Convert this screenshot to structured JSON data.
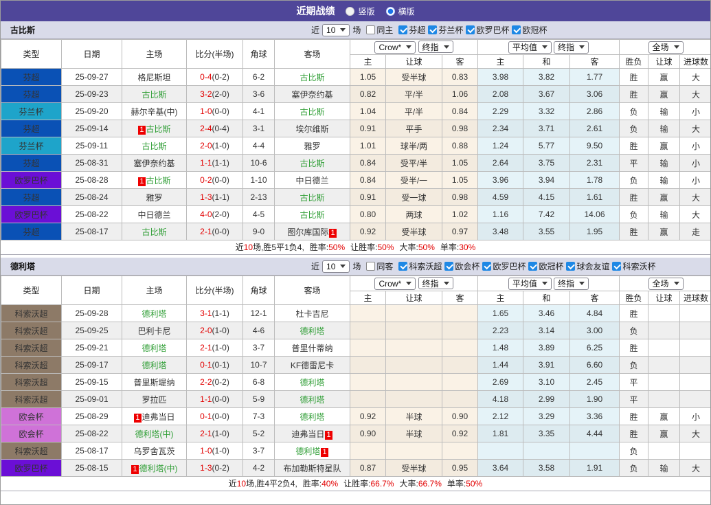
{
  "header": {
    "title": "近期战绩",
    "radio1_label": "竖版",
    "radio1_state": "off",
    "radio2_label": "横版",
    "radio2_state": "on"
  },
  "labels": {
    "recent": "近",
    "games": "场",
    "col_type": "类型",
    "col_date": "日期",
    "col_home": "主场",
    "col_score": "比分(半场)",
    "col_corner": "角球",
    "col_away": "客场",
    "crow": "Crow*",
    "final": "终指",
    "avg": "平均值",
    "full": "全场",
    "home": "主",
    "handicap": "让球",
    "away": "客",
    "draw": "和",
    "result": "胜负",
    "goals": "进球数",
    "sum_prefix": "近",
    "sum_games_suffix": "场,",
    "win_rate": "胜率:",
    "hcap_rate": "让胜率:",
    "big_rate": "大率:",
    "single_rate": "单率:"
  },
  "colors": {
    "topbar": "#4f4699",
    "section_strip": "#d9dbe9",
    "league_colors": {
      "芬超": "#0a51b5",
      "芬兰杯": "#1ea4ca",
      "欧罗巴杯": "#6b0fd6",
      "科索沃超": "#8d7a67",
      "欧会杯": "#cf72d8"
    },
    "win_red": "#e20000",
    "lose_blue": "#2323c8",
    "draw_green": "#2f9e35",
    "team_green": "#2f9e35"
  },
  "sections": [
    {
      "team": "古比斯",
      "count": "10",
      "same_label": "同主",
      "same_state": "off",
      "leagues": [
        "芬超",
        "芬兰杯",
        "欧罗巴杯",
        "欧冠杯"
      ],
      "rows": [
        {
          "type": "芬超",
          "tclass": "fc",
          "date": "25-09-27",
          "hpre": "",
          "home": "格尼斯坦",
          "hcls": "",
          "ft": "0-4",
          "ht": "(0-2)",
          "corner": "6-2",
          "away": "古比斯",
          "apost": "",
          "acls": "tg",
          "o1": "1.05",
          "o2": "受半球",
          "o3": "0.83",
          "m1": "3.98",
          "m2": "3.82",
          "m3": "1.77",
          "r1": "胜",
          "r1c": "r",
          "r2": "赢",
          "r2c": "r",
          "r3": "大",
          "r3c": "r"
        },
        {
          "type": "芬超",
          "tclass": "fc",
          "date": "25-09-23",
          "hpre": "",
          "home": "古比斯",
          "hcls": "tg",
          "ft": "3-2",
          "ht": "(2-0)",
          "corner": "3-6",
          "away": "塞伊奈约基",
          "apost": "",
          "acls": "",
          "o1": "0.82",
          "o2": "平/半",
          "o3": "1.06",
          "m1": "2.08",
          "m2": "3.67",
          "m3": "3.06",
          "r1": "胜",
          "r1c": "r",
          "r2": "赢",
          "r2c": "r",
          "r3": "大",
          "r3c": "r"
        },
        {
          "type": "芬兰杯",
          "tclass": "fl",
          "date": "25-09-20",
          "hpre": "",
          "home": "赫尔辛基(中)",
          "hcls": "",
          "ft": "1-0",
          "ht": "(0-0)",
          "corner": "4-1",
          "away": "古比斯",
          "apost": "",
          "acls": "tg",
          "o1": "1.04",
          "o2": "平/半",
          "o3": "0.84",
          "m1": "2.29",
          "m2": "3.32",
          "m3": "2.86",
          "r1": "负",
          "r1c": "b",
          "r2": "输",
          "r2c": "b",
          "r3": "小",
          "r3c": "b"
        },
        {
          "type": "芬超",
          "tclass": "fc",
          "date": "25-09-14",
          "hpre": "1",
          "home": "古比斯",
          "hcls": "tg",
          "ft": "2-4",
          "ht": "(0-4)",
          "corner": "3-1",
          "away": "埃尔维斯",
          "apost": "",
          "acls": "",
          "o1": "0.91",
          "o2": "平手",
          "o3": "0.98",
          "m1": "2.34",
          "m2": "3.71",
          "m3": "2.61",
          "r1": "负",
          "r1c": "b",
          "r2": "输",
          "r2c": "b",
          "r3": "大",
          "r3c": "r"
        },
        {
          "type": "芬兰杯",
          "tclass": "fl",
          "date": "25-09-11",
          "hpre": "",
          "home": "古比斯",
          "hcls": "tg",
          "ft": "2-0",
          "ht": "(1-0)",
          "corner": "4-4",
          "away": "雅罗",
          "apost": "",
          "acls": "",
          "o1": "1.01",
          "o2": "球半/两",
          "o3": "0.88",
          "m1": "1.24",
          "m2": "5.77",
          "m3": "9.50",
          "r1": "胜",
          "r1c": "r",
          "r2": "赢",
          "r2c": "r",
          "r3": "小",
          "r3c": "b"
        },
        {
          "type": "芬超",
          "tclass": "fc",
          "date": "25-08-31",
          "hpre": "",
          "home": "塞伊奈约基",
          "hcls": "",
          "ft": "1-1",
          "ht": "(1-1)",
          "corner": "10-6",
          "away": "古比斯",
          "apost": "",
          "acls": "tg",
          "o1": "0.84",
          "o2": "受平/半",
          "o3": "1.05",
          "m1": "2.64",
          "m2": "3.75",
          "m3": "2.31",
          "r1": "平",
          "r1c": "g",
          "r2": "输",
          "r2c": "b",
          "r3": "小",
          "r3c": "b"
        },
        {
          "type": "欧罗巴杯",
          "tclass": "eu",
          "date": "25-08-28",
          "hpre": "1",
          "home": "古比斯",
          "hcls": "tg",
          "ft": "0-2",
          "ht": "(0-0)",
          "corner": "1-10",
          "away": "中日德兰",
          "apost": "",
          "acls": "",
          "o1": "0.84",
          "o2": "受半/一",
          "o3": "1.05",
          "m1": "3.96",
          "m2": "3.94",
          "m3": "1.78",
          "r1": "负",
          "r1c": "b",
          "r2": "输",
          "r2c": "b",
          "r3": "小",
          "r3c": "b"
        },
        {
          "type": "芬超",
          "tclass": "fc",
          "date": "25-08-24",
          "hpre": "",
          "home": "雅罗",
          "hcls": "",
          "ft": "1-3",
          "ht": "(1-1)",
          "corner": "2-13",
          "away": "古比斯",
          "apost": "",
          "acls": "tg",
          "o1": "0.91",
          "o2": "受一球",
          "o3": "0.98",
          "m1": "4.59",
          "m2": "4.15",
          "m3": "1.61",
          "r1": "胜",
          "r1c": "r",
          "r2": "赢",
          "r2c": "r",
          "r3": "大",
          "r3c": "r"
        },
        {
          "type": "欧罗巴杯",
          "tclass": "eu",
          "date": "25-08-22",
          "hpre": "",
          "home": "中日德兰",
          "hcls": "",
          "ft": "4-0",
          "ht": "(2-0)",
          "corner": "4-5",
          "away": "古比斯",
          "apost": "",
          "acls": "tg",
          "o1": "0.80",
          "o2": "两球",
          "o3": "1.02",
          "m1": "1.16",
          "m2": "7.42",
          "m3": "14.06",
          "r1": "负",
          "r1c": "b",
          "r2": "输",
          "r2c": "b",
          "r3": "大",
          "r3c": "r"
        },
        {
          "type": "芬超",
          "tclass": "fc",
          "date": "25-08-17",
          "hpre": "",
          "home": "古比斯",
          "hcls": "tg",
          "ft": "2-1",
          "ht": "(0-0)",
          "corner": "9-0",
          "away": "图尔库国际",
          "apost": "1",
          "acls": "",
          "o1": "0.92",
          "o2": "受半球",
          "o3": "0.97",
          "m1": "3.48",
          "m2": "3.55",
          "m3": "1.95",
          "r1": "胜",
          "r1c": "r",
          "r2": "赢",
          "r2c": "r",
          "r3": "走",
          "r3c": "g"
        }
      ],
      "summary": {
        "games": "10",
        "record": "胜5平1负4,",
        "win": "50%",
        "hcap": "50%",
        "big": "50%",
        "single": "30%"
      }
    },
    {
      "team": "德利塔",
      "count": "10",
      "same_label": "同客",
      "same_state": "off",
      "leagues": [
        "科索沃超",
        "欧会杯",
        "欧罗巴杯",
        "欧冠杯",
        "球会友谊",
        "科索沃杯"
      ],
      "rows": [
        {
          "type": "科索沃超",
          "tclass": "ks",
          "date": "25-09-28",
          "hpre": "",
          "home": "德利塔",
          "hcls": "tg",
          "ft": "3-1",
          "ht": "(1-1)",
          "corner": "12-1",
          "away": "杜卡吉尼",
          "apost": "",
          "acls": "",
          "o1": "",
          "o2": "",
          "o3": "",
          "m1": "1.65",
          "m2": "3.46",
          "m3": "4.84",
          "r1": "胜",
          "r1c": "r",
          "r2": "",
          "r2c": "",
          "r3": "",
          "r3c": ""
        },
        {
          "type": "科索沃超",
          "tclass": "ks",
          "date": "25-09-25",
          "hpre": "",
          "home": "巴利卡尼",
          "hcls": "",
          "ft": "2-0",
          "ht": "(1-0)",
          "corner": "4-6",
          "away": "德利塔",
          "apost": "",
          "acls": "tg",
          "o1": "",
          "o2": "",
          "o3": "",
          "m1": "2.23",
          "m2": "3.14",
          "m3": "3.00",
          "r1": "负",
          "r1c": "b",
          "r2": "",
          "r2c": "",
          "r3": "",
          "r3c": ""
        },
        {
          "type": "科索沃超",
          "tclass": "ks",
          "date": "25-09-21",
          "hpre": "",
          "home": "德利塔",
          "hcls": "tg",
          "ft": "2-1",
          "ht": "(1-0)",
          "corner": "3-7",
          "away": "普里什蒂纳",
          "apost": "",
          "acls": "",
          "o1": "",
          "o2": "",
          "o3": "",
          "m1": "1.48",
          "m2": "3.89",
          "m3": "6.25",
          "r1": "胜",
          "r1c": "r",
          "r2": "",
          "r2c": "",
          "r3": "",
          "r3c": ""
        },
        {
          "type": "科索沃超",
          "tclass": "ks",
          "date": "25-09-17",
          "hpre": "",
          "home": "德利塔",
          "hcls": "tg",
          "ft": "0-1",
          "ht": "(0-1)",
          "corner": "10-7",
          "away": "KF德雷尼卡",
          "apost": "",
          "acls": "",
          "o1": "",
          "o2": "",
          "o3": "",
          "m1": "1.44",
          "m2": "3.91",
          "m3": "6.60",
          "r1": "负",
          "r1c": "b",
          "r2": "",
          "r2c": "",
          "r3": "",
          "r3c": ""
        },
        {
          "type": "科索沃超",
          "tclass": "ks",
          "date": "25-09-15",
          "hpre": "",
          "home": "普里斯堤纳",
          "hcls": "",
          "ft": "2-2",
          "ht": "(0-2)",
          "corner": "6-8",
          "away": "德利塔",
          "apost": "",
          "acls": "tg",
          "o1": "",
          "o2": "",
          "o3": "",
          "m1": "2.69",
          "m2": "3.10",
          "m3": "2.45",
          "r1": "平",
          "r1c": "g",
          "r2": "",
          "r2c": "",
          "r3": "",
          "r3c": ""
        },
        {
          "type": "科索沃超",
          "tclass": "ks",
          "date": "25-09-01",
          "hpre": "",
          "home": "罗拉匹",
          "hcls": "",
          "ft": "1-1",
          "ht": "(0-0)",
          "corner": "5-9",
          "away": "德利塔",
          "apost": "",
          "acls": "tg",
          "o1": "",
          "o2": "",
          "o3": "",
          "m1": "4.18",
          "m2": "2.99",
          "m3": "1.90",
          "r1": "平",
          "r1c": "g",
          "r2": "",
          "r2c": "",
          "r3": "",
          "r3c": ""
        },
        {
          "type": "欧会杯",
          "tclass": "ec",
          "date": "25-08-29",
          "hpre": "1",
          "home": "迪弗当日",
          "hcls": "",
          "ft": "0-1",
          "ht": "(0-0)",
          "corner": "7-3",
          "away": "德利塔",
          "apost": "",
          "acls": "tg",
          "o1": "0.92",
          "o2": "半球",
          "o3": "0.90",
          "m1": "2.12",
          "m2": "3.29",
          "m3": "3.36",
          "r1": "胜",
          "r1c": "r",
          "r2": "赢",
          "r2c": "r",
          "r3": "小",
          "r3c": "b"
        },
        {
          "type": "欧会杯",
          "tclass": "ec",
          "date": "25-08-22",
          "hpre": "",
          "home": "德利塔(中)",
          "hcls": "tg",
          "ft": "2-1",
          "ht": "(1-0)",
          "corner": "5-2",
          "away": "迪弗当日",
          "apost": "1",
          "acls": "",
          "o1": "0.90",
          "o2": "半球",
          "o3": "0.92",
          "m1": "1.81",
          "m2": "3.35",
          "m3": "4.44",
          "r1": "胜",
          "r1c": "r",
          "r2": "赢",
          "r2c": "r",
          "r3": "大",
          "r3c": "r"
        },
        {
          "type": "科索沃超",
          "tclass": "ks",
          "date": "25-08-17",
          "hpre": "",
          "home": "乌罗舍瓦茨",
          "hcls": "",
          "ft": "1-0",
          "ht": "(1-0)",
          "corner": "3-7",
          "away": "德利塔",
          "apost": "1",
          "acls": "tg",
          "o1": "",
          "o2": "",
          "o3": "",
          "m1": "",
          "m2": "",
          "m3": "",
          "r1": "负",
          "r1c": "b",
          "r2": "",
          "r2c": "",
          "r3": "",
          "r3c": ""
        },
        {
          "type": "欧罗巴杯",
          "tclass": "eu",
          "date": "25-08-15",
          "hpre": "1",
          "home": "德利塔(中)",
          "hcls": "tg",
          "ft": "1-3",
          "ht": "(0-2)",
          "corner": "4-2",
          "away": "布加勒斯特星队",
          "apost": "",
          "acls": "",
          "o1": "0.87",
          "o2": "受半球",
          "o3": "0.95",
          "m1": "3.64",
          "m2": "3.58",
          "m3": "1.91",
          "r1": "负",
          "r1c": "b",
          "r2": "输",
          "r2c": "b",
          "r3": "大",
          "r3c": "r"
        }
      ],
      "summary": {
        "games": "10",
        "record": "胜4平2负4,",
        "win": "40%",
        "hcap": "66.7%",
        "big": "66.7%",
        "single": "50%"
      }
    }
  ]
}
